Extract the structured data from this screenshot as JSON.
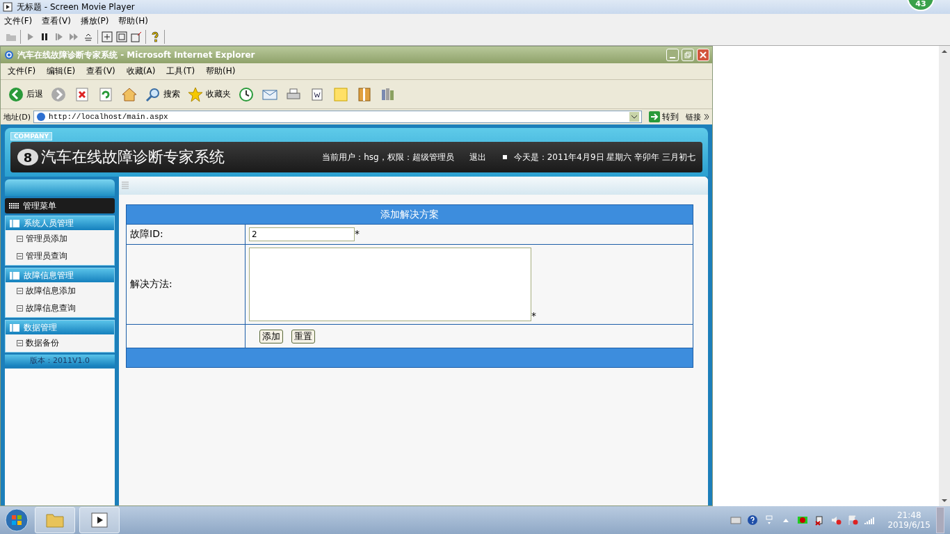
{
  "player": {
    "title": "无标题 - Screen Movie Player",
    "menu": [
      "文件(F)",
      "查看(V)",
      "播放(P)",
      "帮助(H)"
    ],
    "badge": "43"
  },
  "ie": {
    "title": "汽车在线故障诊断专家系统 - Microsoft Internet Explorer",
    "menu": [
      "文件(F)",
      "编辑(E)",
      "查看(V)",
      "收藏(A)",
      "工具(T)",
      "帮助(H)"
    ],
    "toolbar": [
      {
        "kind": "back",
        "label": "后退"
      },
      {
        "kind": "forward"
      },
      {
        "kind": "stop"
      },
      {
        "kind": "refresh"
      },
      {
        "kind": "home"
      },
      {
        "kind": "search",
        "label": "搜索"
      },
      {
        "kind": "favorites",
        "label": "收藏夹"
      },
      {
        "kind": "history"
      },
      {
        "kind": "mail"
      },
      {
        "kind": "print"
      },
      {
        "kind": "edit"
      },
      {
        "kind": "note"
      },
      {
        "kind": "book"
      },
      {
        "kind": "research"
      }
    ],
    "address_label": "地址(D)",
    "url": "http://localhost/main.aspx",
    "go": "转到",
    "links": "链接"
  },
  "header": {
    "company": "COMPANY",
    "logo_mark": "8",
    "title": "汽车在线故障诊断专家系统",
    "user": "当前用户：hsg，权限：超级管理员",
    "logout": "退出",
    "date": "今天是：2011年4月9日 星期六 辛卯年 三月初七"
  },
  "sidebar": {
    "title": "管理菜单",
    "groups": [
      {
        "title": "系统人员管理",
        "items": [
          "管理员添加",
          "管理员查询"
        ]
      },
      {
        "title": "故障信息管理",
        "items": [
          "故障信息添加",
          "故障信息查询"
        ]
      },
      {
        "title": "数据管理",
        "items": [
          "数据备份"
        ]
      }
    ],
    "version": "版本：2011V1.0"
  },
  "form": {
    "title": "添加解决方案",
    "fields": [
      {
        "kind": "input",
        "label": "故障ID:",
        "value": "2",
        "required": "*"
      },
      {
        "kind": "textarea",
        "label": "解决方法:",
        "required": "*"
      }
    ],
    "buttons": [
      "添加",
      "重置"
    ]
  },
  "taskbar": {
    "time": "21:48",
    "date": "2019/6/15"
  }
}
